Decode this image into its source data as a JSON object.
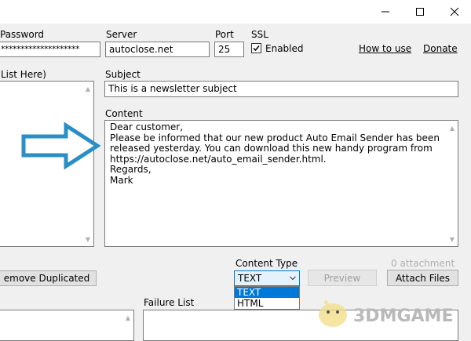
{
  "window": {
    "controls": [
      "minimize-icon",
      "maximize-icon",
      "close-icon"
    ]
  },
  "smtp": {
    "password_label": "Password",
    "password_value": "********************",
    "server_label": "Server",
    "server_value": "autoclose.net",
    "port_label": "Port",
    "port_value": "25",
    "ssl_label": "SSL",
    "ssl_checkbox_label": "Enabled",
    "ssl_checked": true
  },
  "links": {
    "how_to_use": "How to use",
    "donate": "Donate"
  },
  "recipients": {
    "label": "List Here)"
  },
  "subject": {
    "label": "Subject",
    "value": "This is a newsletter subject"
  },
  "content": {
    "label": "Content",
    "lines": [
      "Dear customer,",
      "",
      "Please be informed that our new product Auto Email Sender has been",
      "released yesterday. You can download this new handy program from",
      "https://autoclose.net/auto_email_sender.html.",
      "",
      "",
      "Regards,",
      "Mark"
    ]
  },
  "content_type": {
    "label": "Content Type",
    "selected": "TEXT",
    "options": [
      "TEXT",
      "HTML"
    ]
  },
  "attachments": {
    "count_text": "0 attachment",
    "preview_button": "Preview",
    "attach_button": "Attach Files"
  },
  "buttons": {
    "remove_duplicated": "emove Duplicated"
  },
  "failure_list": {
    "label": "Failure List"
  },
  "watermark": {
    "text": "3DMGAME"
  },
  "colors": {
    "window_bg": "#f0f0f0",
    "selection": "#0078d7",
    "arrow": "#2a8fc7"
  }
}
